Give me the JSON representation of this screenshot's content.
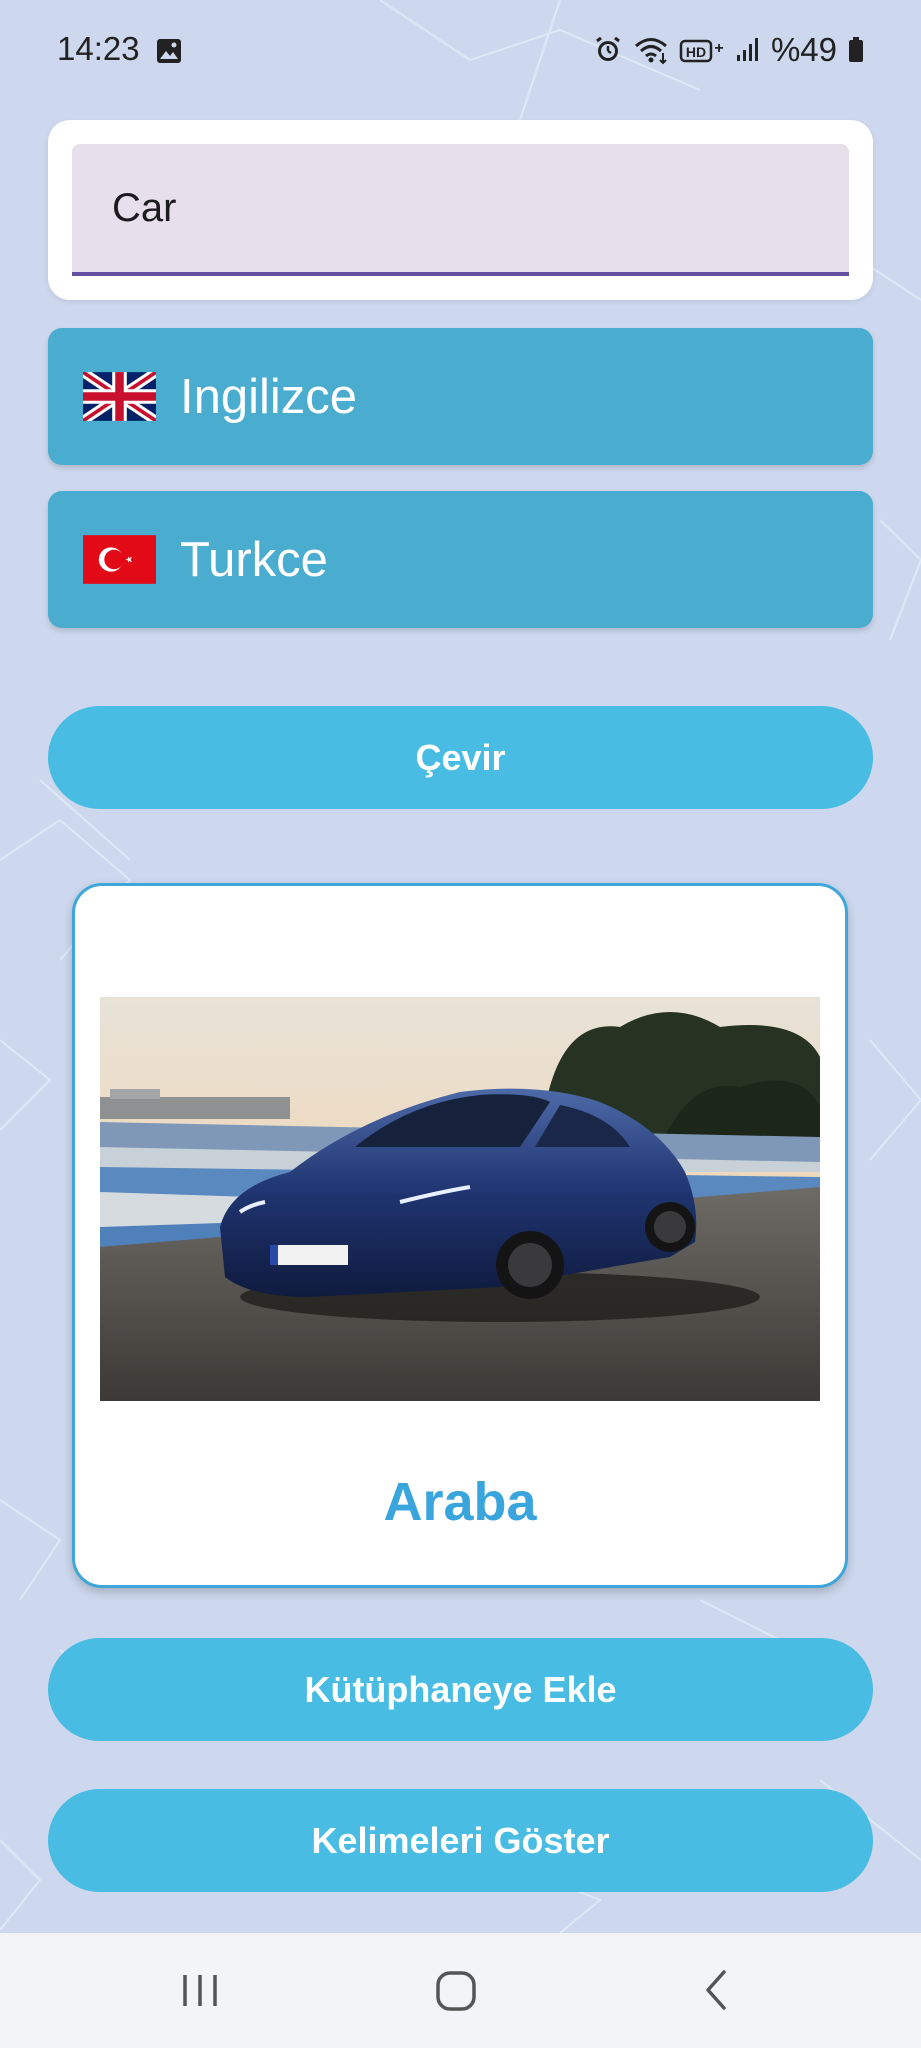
{
  "status_bar": {
    "time": "14:23",
    "battery_text": "%49",
    "icons": [
      "gallery-icon",
      "alarm-icon",
      "wifi-icon",
      "hd-plus-icon",
      "signal-icon",
      "battery-icon"
    ]
  },
  "input": {
    "value": "Car"
  },
  "source_language": {
    "label": "Ingilizce",
    "flag": "uk-flag-icon"
  },
  "target_language": {
    "label": "Turkce",
    "flag": "turkey-flag-icon"
  },
  "translate_button": {
    "label": "Çevir"
  },
  "result": {
    "image": "car-photo",
    "word": "Araba"
  },
  "actions": {
    "add_to_library": "Kütüphaneye Ekle",
    "show_words": "Kelimeleri Göster"
  },
  "nav_bar": {
    "buttons": [
      "recents-icon",
      "home-icon",
      "back-icon"
    ]
  },
  "colors": {
    "background": "#cdd8ee",
    "language_select": "#4aaccf",
    "button": "#48bce2",
    "result_text": "#3aa4dc",
    "input_underline": "#6750a4",
    "input_fill": "#e7dfec"
  }
}
